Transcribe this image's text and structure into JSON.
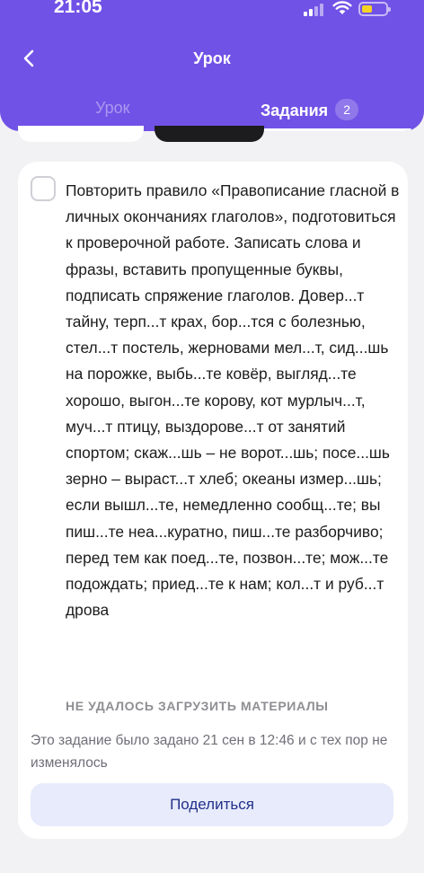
{
  "status_bar": {
    "time": "21:05",
    "signal_icon": "cellular-signal-icon",
    "wifi_icon": "wifi-icon",
    "battery_icon": "battery-icon",
    "battery_color": "#f5d323"
  },
  "header": {
    "back_icon": "chevron-left-icon",
    "title": "Урок",
    "accent_color": "#7152e6"
  },
  "tabs": [
    {
      "label": "Урок",
      "active": false
    },
    {
      "label": "Задания",
      "badge": "2",
      "active": true
    }
  ],
  "task": {
    "completed": false,
    "text": "Повторить правило «Правописание гласной в личных окончаниях глаголов», подготовиться к проверочной работе. Записать слова и фразы, вставить пропущенные буквы, подписать спряжение глаголов. Довер...т тайну, терп...т крах, бор...тся с болезнью, стел...т постель, жерновами мел...т, сид...шь на порожке, выбь...те ковёр, выгляд...те хорошо, выгон...те корову, кот мурлыч...т, муч...т птицу, выздорове...т от занятий спортом; скаж...шь – не ворот...шь; посе...шь зерно – выраст...т хлеб; океаны измер...шь; если вышл...те, немедленно сообщ...те; вы пиш...те неа...куратно, пиш...те разборчиво; перед тем как поед...те, позвон...те; мож...те подождать; приед...те к нам; кол...т и руб...т дрова",
    "materials_error": "НЕ УДАЛОСЬ ЗАГРУЗИТЬ МАТЕРИАЛЫ",
    "assigned_note": "Это задание было задано 21 сен в 12:46 и с тех пор не изменялось",
    "share_label": "Поделиться"
  }
}
